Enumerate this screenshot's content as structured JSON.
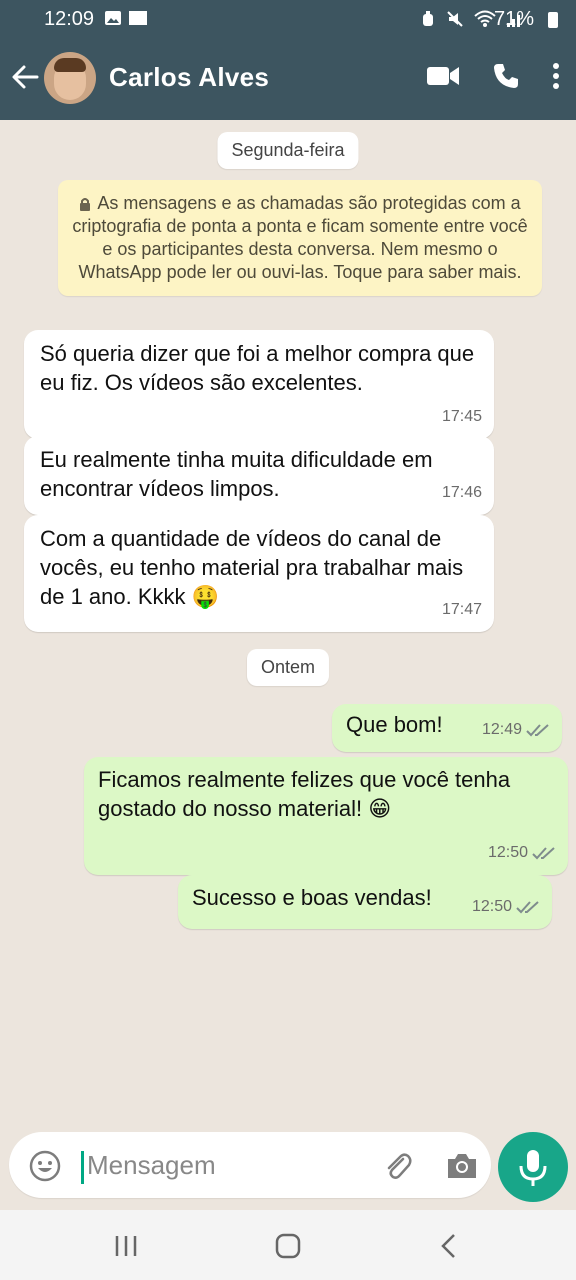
{
  "statusbar": {
    "time": "12:09",
    "battery": "71%"
  },
  "header": {
    "title": "Carlos Alves"
  },
  "chat": {
    "day_chip_1": "Segunda-feira",
    "notice": "As mensagens e as chamadas são protegidas com a criptografia de ponta a ponta e ficam somente entre você e os participantes desta conversa. Nem mesmo o WhatsApp pode ler ou ouvi-las. Toque para saber mais.",
    "messages_in": [
      {
        "text": "Só queria dizer que foi a melhor compra que eu fiz. Os vídeos são excelentes.",
        "time": "17:45"
      },
      {
        "text": "Eu realmente tinha muita dificuldade em encontrar vídeos limpos.",
        "time": "17:46"
      },
      {
        "text": "Com a quantidade de vídeos do canal de vocês, eu tenho material pra trabalhar mais de 1 ano. Kkkk 🤑",
        "time": "17:47"
      }
    ],
    "day_chip_2": "Ontem",
    "messages_out": [
      {
        "text": "Que bom!",
        "time": "12:49"
      },
      {
        "text": "Ficamos realmente felizes que você tenha gostado do nosso material! 😁",
        "time": "12:50"
      },
      {
        "text": "Sucesso e boas vendas!",
        "time": "12:50"
      }
    ]
  },
  "composer": {
    "placeholder": "Mensagem"
  }
}
